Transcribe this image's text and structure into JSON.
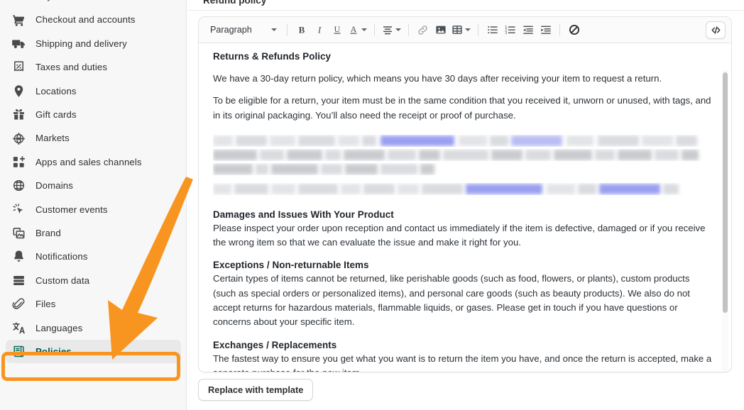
{
  "sidebar": {
    "items": [
      {
        "label": "Payments",
        "icon": "payments-icon",
        "active": false
      },
      {
        "label": "Checkout and accounts",
        "icon": "cart-icon",
        "active": false
      },
      {
        "label": "Shipping and delivery",
        "icon": "truck-icon",
        "active": false
      },
      {
        "label": "Taxes and duties",
        "icon": "receipt-percent-icon",
        "active": false
      },
      {
        "label": "Locations",
        "icon": "map-pin-icon",
        "active": false
      },
      {
        "label": "Gift cards",
        "icon": "gift-icon",
        "active": false
      },
      {
        "label": "Markets",
        "icon": "globe-target-icon",
        "active": false
      },
      {
        "label": "Apps and sales channels",
        "icon": "apps-plus-icon",
        "active": false
      },
      {
        "label": "Domains",
        "icon": "globe-icon",
        "active": false
      },
      {
        "label": "Customer events",
        "icon": "cursor-click-icon",
        "active": false
      },
      {
        "label": "Brand",
        "icon": "brand-image-icon",
        "active": false
      },
      {
        "label": "Notifications",
        "icon": "bell-icon",
        "active": false
      },
      {
        "label": "Custom data",
        "icon": "database-icon",
        "active": false
      },
      {
        "label": "Files",
        "icon": "paperclip-icon",
        "active": false
      },
      {
        "label": "Languages",
        "icon": "translate-icon",
        "active": false
      },
      {
        "label": "Policies",
        "icon": "scroll-document-icon",
        "active": true
      }
    ]
  },
  "main": {
    "section_title": "Refund policy",
    "toolbar": {
      "block_format": "Paragraph",
      "buttons": [
        {
          "name": "bold-button",
          "glyph": "B"
        },
        {
          "name": "italic-button",
          "glyph": "I"
        },
        {
          "name": "underline-button",
          "glyph": "U"
        },
        {
          "name": "text-color-button",
          "glyph": "A"
        },
        {
          "name": "align-button",
          "glyph": "align"
        },
        {
          "name": "link-button",
          "glyph": "link"
        },
        {
          "name": "image-button",
          "glyph": "image"
        },
        {
          "name": "table-button",
          "glyph": "table"
        },
        {
          "name": "bulleted-list-button",
          "glyph": "ul"
        },
        {
          "name": "numbered-list-button",
          "glyph": "ol"
        },
        {
          "name": "outdent-button",
          "glyph": "outdent"
        },
        {
          "name": "indent-button",
          "glyph": "indent"
        },
        {
          "name": "clear-formatting-button",
          "glyph": "clear"
        },
        {
          "name": "code-view-button",
          "glyph": "</>"
        }
      ]
    },
    "document": {
      "heading_1": "Returns & Refunds Policy",
      "para_1": "We have a 30-day return policy, which means you have 30 days after receiving your item to request a return.",
      "para_2": "To be eligible for a return, your item must be in the same condition that you received it, unworn or unused, with tags, and in its original packaging. You’ll also need the receipt or proof of purchase.",
      "redacted_note": "blurred paragraph block with highlighted link text",
      "heading_2": "Damages and Issues With Your Product",
      "para_3": "Please inspect your order upon reception and contact us immediately if the item is defective, damaged or if you receive the wrong item so that we can evaluate the issue and make it right for you.",
      "heading_3": "Exceptions / Non-returnable Items",
      "para_4": "Certain types of items cannot be returned, like perishable goods (such as food, flowers, or plants), custom products (such as special orders or personalized items), and personal care goods (such as beauty products). We also do not accept returns for hazardous materials, flammable liquids, or gases. Please get in touch if you have questions or concerns about your specific item.",
      "heading_4": "Exchanges / Replacements",
      "para_5": "The fastest way to ensure you get what you want is to return the item you have, and once the return is accepted, make a separate purchase for the new item."
    },
    "replace_button_label": "Replace with template"
  },
  "annotation": {
    "color": "#f89520",
    "target": "Policies",
    "shapes": [
      "arrow-pointing-down-left",
      "highlight-rectangle"
    ]
  }
}
